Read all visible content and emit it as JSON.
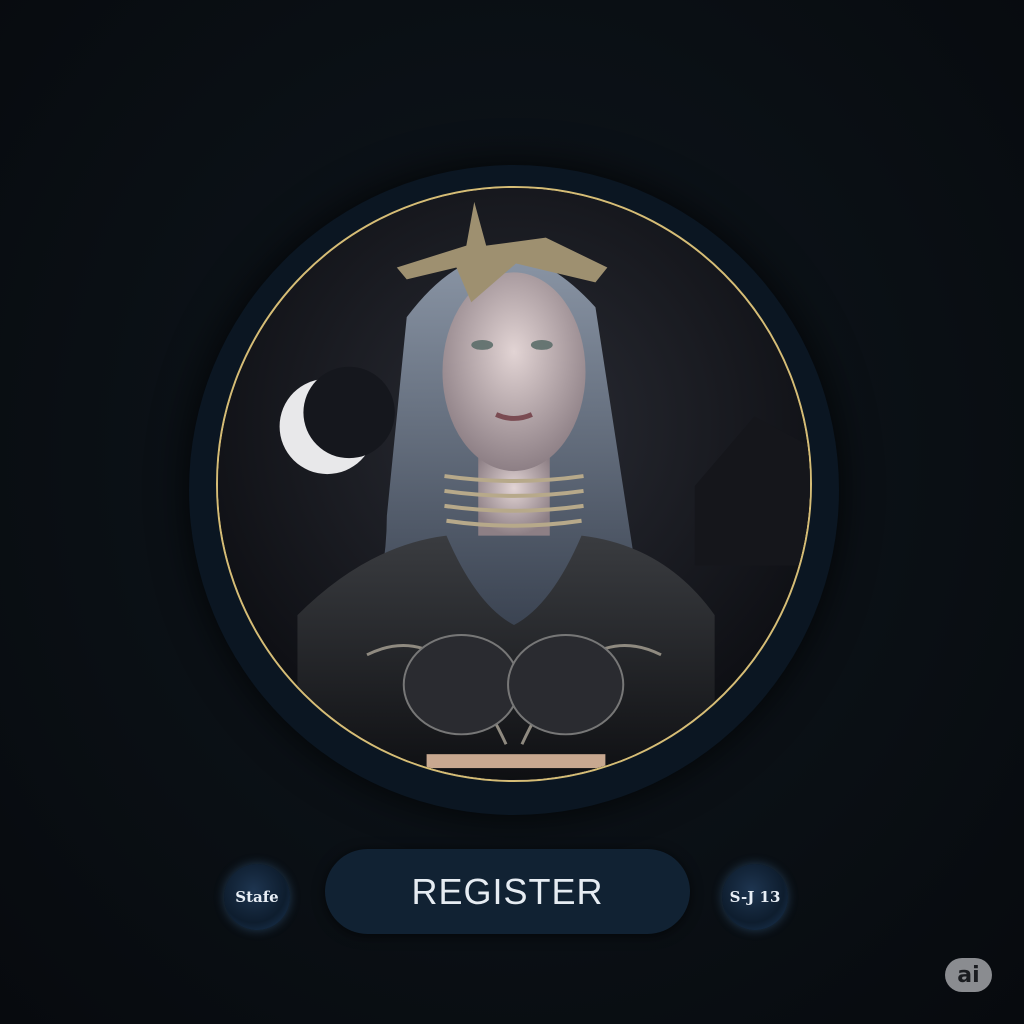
{
  "portrait": {
    "alt_subject": "warrior-woman-portrait"
  },
  "buttons": {
    "left_label": "Stafe",
    "register_label": "REGISTER",
    "right_label": "S-J 13"
  },
  "badge": {
    "label": "ai"
  },
  "colors": {
    "accent_ring": "#d6bd76",
    "button_bg": "#112233",
    "background": "#0a0f14"
  }
}
